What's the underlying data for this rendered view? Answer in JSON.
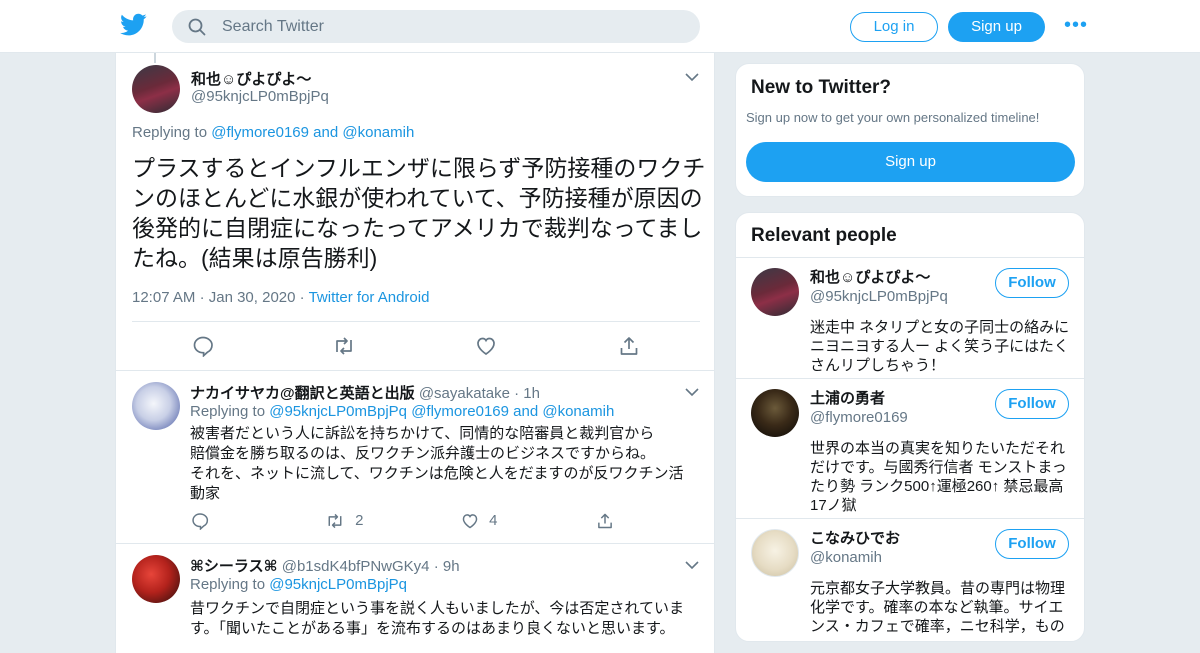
{
  "header": {
    "search_placeholder": "Search Twitter",
    "login_label": "Log in",
    "signup_label": "Sign up",
    "more_label": "•••"
  },
  "main_tweet": {
    "author_name": "和也☺ぴよぴよ～",
    "author_handle": "@95knjcLP0mBpjPq",
    "replying_prefix": "Replying to",
    "reply_to_1": "@flymore0169",
    "and": "and",
    "reply_to_2": "@konamih",
    "text": "プラスするとインフルエンザに限らず予防接種のワクチンのほとんどに水銀が使われていて、予防接種が原因の後発的に自閉症になったってアメリカで裁判なってましたね。(結果は原告勝利)",
    "time": "12:07 AM",
    "date": "Jan 30, 2020",
    "sep": "·",
    "source": "Twitter for Android"
  },
  "replies": [
    {
      "name": "ナカイサヤカ@翻訳と英語と出版",
      "handle": "@sayakatake",
      "sep": "·",
      "age": "1h",
      "replying_prefix": "Replying to",
      "to": [
        "@95knjcLP0mBpjPq",
        "@flymore0169"
      ],
      "and": "and",
      "to_last": "@konamih",
      "text_lines": [
        "被害者だという人に訴訟を持ちかけて、同情的な陪審員と裁判官から",
        "賠償金を勝ち取るのは、反ワクチン派弁護士のビジネスですからね。",
        "それを、ネットに流して、ワクチンは危険と人をだますのが反ワクチン活動家"
      ],
      "retweets": "2",
      "likes": "4"
    },
    {
      "name": "⌘シーラス⌘",
      "handle": "@b1sdK4bfPNwGKy4",
      "sep": "·",
      "age": "9h",
      "replying_prefix": "Replying to",
      "to": [
        "@95knjcLP0mBpjPq"
      ],
      "text_lines": [
        "昔ワクチンで自閉症という事を説く人もいましたが、今は否定されています。「聞いたことがある事」を流布するのはあまり良くないと思います。"
      ]
    }
  ],
  "sidebar": {
    "new_title": "New to Twitter?",
    "new_sub": "Sign up now to get your own personalized timeline!",
    "signup_label": "Sign up",
    "relevant_title": "Relevant people",
    "people": [
      {
        "name": "和也☺ぴよぴよ～",
        "handle": "@95knjcLP0mBpjPq",
        "bio": "迷走中 ネタリプと女の子同士の絡みにニヨニヨする人ー よく笑う子にはたくさんリプしちゃう！",
        "follow": "Follow"
      },
      {
        "name": "土浦の勇者",
        "handle": "@flymore0169",
        "bio": "世界の本当の真実を知りたいただそれだけです。与國秀行信者 モンストまったり勢 ランク500↑運極260↑ 禁忌最高17ノ獄",
        "follow": "Follow"
      },
      {
        "name": "こなみひでお",
        "handle": "@konamih",
        "bio": "元京都女子大学教員。昔の専門は物理化学です。確率の本など執筆。サイエンス・カフェで確率，ニセ科学，もの",
        "follow": "Follow"
      }
    ]
  },
  "colors": {
    "accent": "#1da1f2",
    "link": "#1b95e0",
    "muted": "#657786",
    "bg": "#e6ecf0"
  }
}
